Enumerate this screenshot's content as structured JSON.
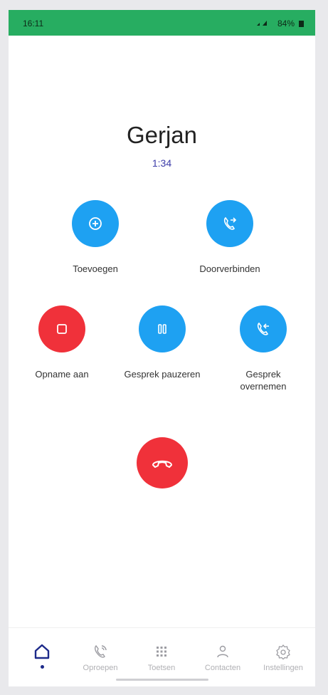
{
  "status_bar": {
    "time": "16:11",
    "battery": "84%"
  },
  "call": {
    "caller": "Gerjan",
    "duration": "1:34"
  },
  "actions": {
    "add": "Toevoegen",
    "transfer": "Doorverbinden",
    "record": "Opname aan",
    "hold": "Gesprek pauzeren",
    "takeover": "Gesprek overnemen"
  },
  "nav": {
    "items": [
      {
        "label": "",
        "icon": "home-icon",
        "active": true
      },
      {
        "label": "Oproepen",
        "icon": "phone-calls-icon"
      },
      {
        "label": "Toetsen",
        "icon": "keypad-icon"
      },
      {
        "label": "Contacten",
        "icon": "contacts-icon"
      },
      {
        "label": "Instellingen",
        "icon": "settings-icon"
      }
    ]
  },
  "colors": {
    "status_bar": "#27ad61",
    "blue": "#1ea1f2",
    "red": "#f0313a",
    "accent": "#1d2a8a"
  }
}
